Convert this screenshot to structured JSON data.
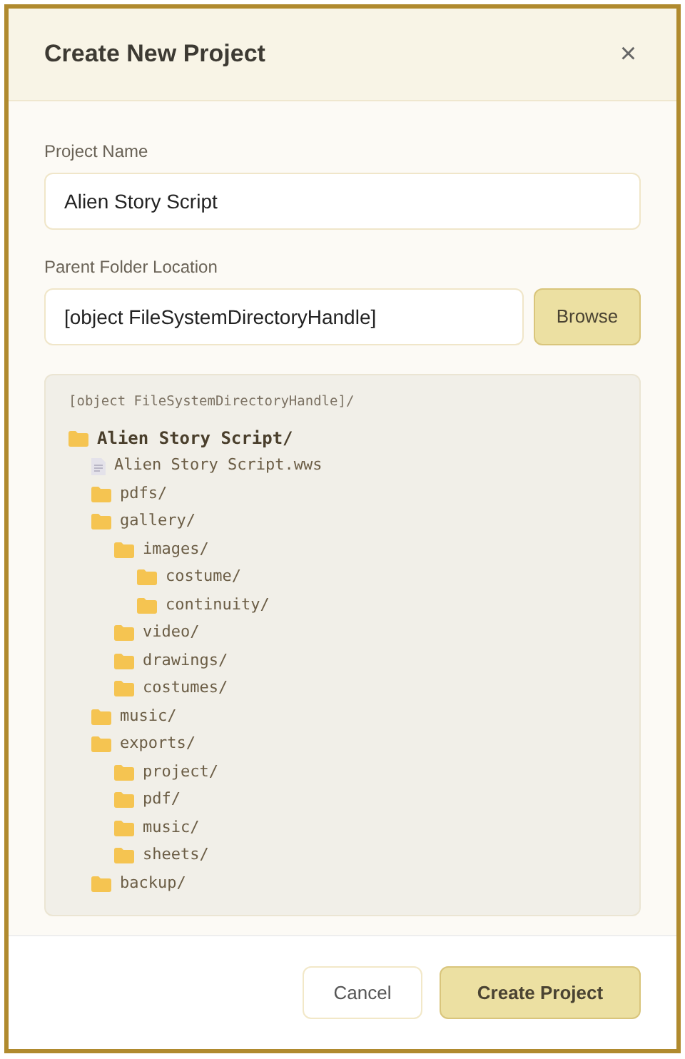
{
  "dialog": {
    "title": "Create New Project",
    "close": "×"
  },
  "project_name": {
    "label": "Project Name",
    "value": "Alien Story Script"
  },
  "parent_folder": {
    "label": "Parent Folder Location",
    "value": "[object FileSystemDirectoryHandle]",
    "browse": "Browse"
  },
  "preview": {
    "path": "[object FileSystemDirectoryHandle]/",
    "tree": [
      {
        "kind": "folder",
        "name": "Alien Story Script/",
        "bold": true,
        "children": [
          {
            "kind": "file",
            "name": "Alien Story Script.wws"
          },
          {
            "kind": "folder",
            "name": "pdfs/"
          },
          {
            "kind": "folder",
            "name": "gallery/",
            "children": [
              {
                "kind": "folder",
                "name": "images/",
                "children": [
                  {
                    "kind": "folder",
                    "name": "costume/"
                  },
                  {
                    "kind": "folder",
                    "name": "continuity/"
                  }
                ]
              },
              {
                "kind": "folder",
                "name": "video/"
              },
              {
                "kind": "folder",
                "name": "drawings/"
              },
              {
                "kind": "folder",
                "name": "costumes/"
              }
            ]
          },
          {
            "kind": "folder",
            "name": "music/"
          },
          {
            "kind": "folder",
            "name": "exports/",
            "children": [
              {
                "kind": "folder",
                "name": "project/"
              },
              {
                "kind": "folder",
                "name": "pdf/"
              },
              {
                "kind": "folder",
                "name": "music/"
              },
              {
                "kind": "folder",
                "name": "sheets/"
              }
            ]
          },
          {
            "kind": "folder",
            "name": "backup/"
          }
        ]
      }
    ]
  },
  "buttons": {
    "cancel": "Cancel",
    "create": "Create Project"
  }
}
